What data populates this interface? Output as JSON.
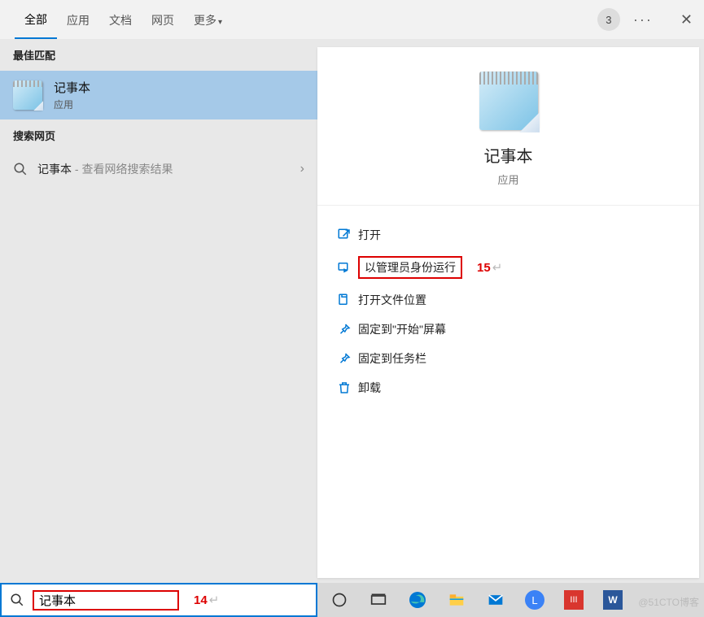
{
  "tabs": {
    "all": "全部",
    "apps": "应用",
    "docs": "文档",
    "web": "网页",
    "more": "更多"
  },
  "header": {
    "badge": "3"
  },
  "left": {
    "best_match_header": "最佳匹配",
    "result": {
      "title": "记事本",
      "sub": "应用"
    },
    "search_web_header": "搜索网页",
    "web_row": {
      "term": "记事本",
      "suffix": " - 查看网络搜索结果"
    }
  },
  "preview": {
    "title": "记事本",
    "sub": "应用"
  },
  "actions": {
    "open": "打开",
    "run_admin": "以管理员身份运行",
    "open_location": "打开文件位置",
    "pin_start": "固定到\"开始\"屏幕",
    "pin_taskbar": "固定到任务栏",
    "uninstall": "卸载",
    "annotation15": "15"
  },
  "search": {
    "value": "记事本",
    "annotation14": "14"
  },
  "watermark": "@51CTO博客"
}
